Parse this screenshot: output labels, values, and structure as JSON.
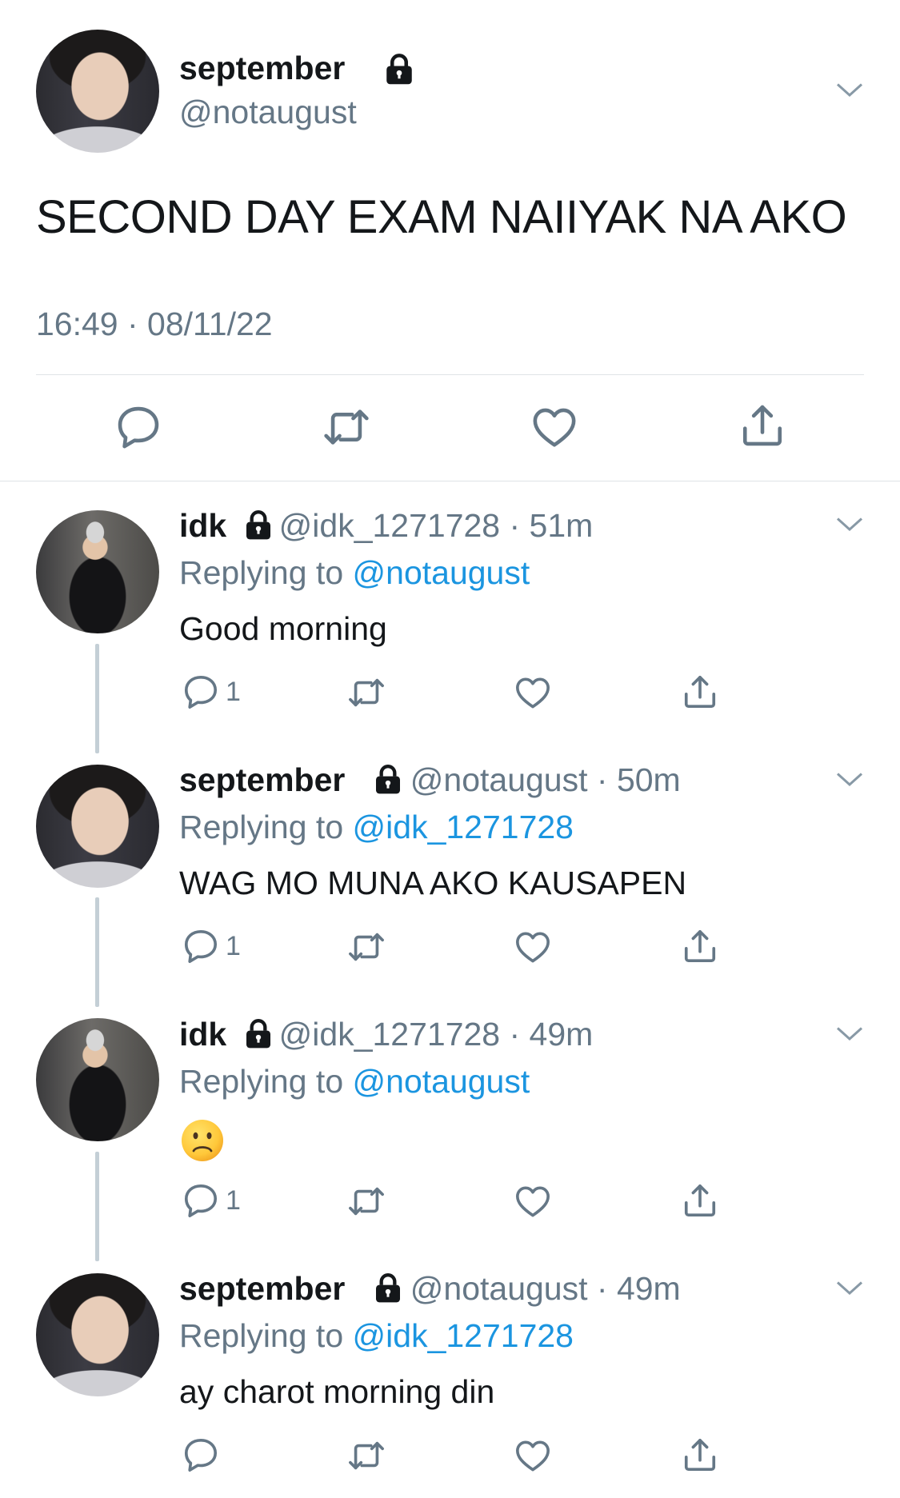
{
  "main_tweet": {
    "display_name": "september",
    "handle": "@notaugust",
    "text": "SECOND DAY EXAM NAIIYAK NA AKO",
    "timestamp": "16:49 · 08/11/22"
  },
  "replies": [
    {
      "display_name": "idk",
      "handle": "@idk_1271728",
      "age": "51m",
      "replying_prefix": "Replying to",
      "replying_to": "@notaugust",
      "text": "Good morning",
      "reply_count": "1"
    },
    {
      "display_name": "september",
      "handle": "@notaugust",
      "age": "50m",
      "replying_prefix": "Replying to",
      "replying_to": "@idk_1271728",
      "text": "WAG MO MUNA AKO KAUSAPEN",
      "reply_count": "1"
    },
    {
      "display_name": "idk",
      "handle": "@idk_1271728",
      "age": "49m",
      "replying_prefix": "Replying to",
      "replying_to": "@notaugust",
      "text": "☹️",
      "reply_count": "1"
    },
    {
      "display_name": "september",
      "handle": "@notaugust",
      "age": "49m",
      "replying_prefix": "Replying to",
      "replying_to": "@idk_1271728",
      "text": "ay charot morning din",
      "reply_count": ""
    }
  ],
  "icons": [
    "lock-icon",
    "chevron-down-icon",
    "reply-icon",
    "retweet-icon",
    "like-icon",
    "share-icon"
  ],
  "colors": {
    "text": "#14171a",
    "secondary": "#657786",
    "link": "#1b95e0",
    "divider": "#dfe3e6",
    "thread_line": "#c4cfd6"
  }
}
